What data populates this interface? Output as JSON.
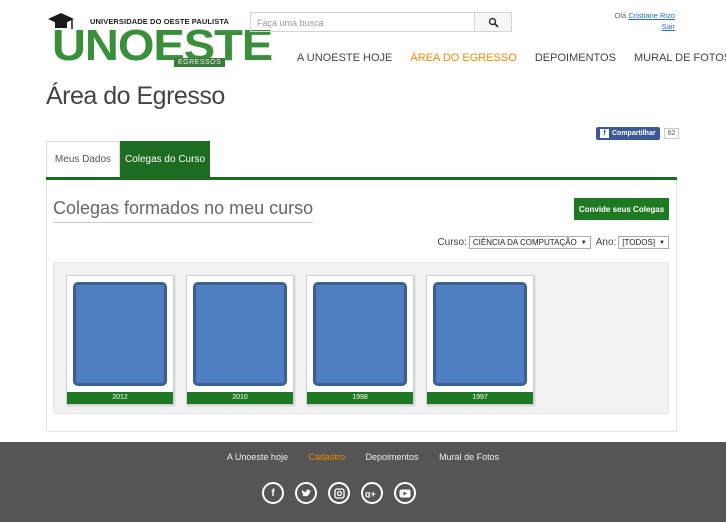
{
  "header": {
    "university_name": "UNIVERSIDADE DO OESTE PAULISTA",
    "brand": "UNOESTE",
    "brand_sub": "EGRESSOS",
    "search_placeholder": "Faça uma busca",
    "greeting": "Olá",
    "user_name": "Cristiane Rizo",
    "logout": "Sair"
  },
  "nav": {
    "items": [
      {
        "label": "A UNOESTE HOJE",
        "active": false
      },
      {
        "label": "ÁREA DO EGRESSO",
        "active": true
      },
      {
        "label": "DEPOIMENTOS",
        "active": false
      },
      {
        "label": "MURAL DE FOTOS",
        "active": false
      }
    ]
  },
  "page": {
    "title": "Área do Egresso",
    "share_label": "Compartilhar",
    "share_count": "62"
  },
  "tabs": [
    {
      "label": "Meus Dados",
      "active": false
    },
    {
      "label": "Colegas do Curso",
      "active": true
    }
  ],
  "section": {
    "title": "Colegas formados no meu curso",
    "invite_button": "Convide seus Colegas",
    "course_label": "Curso:",
    "course_value": "CIÊNCIA DA COMPUTAÇÃO",
    "year_label": "Ano:",
    "year_value": "[TODOS]"
  },
  "gallery": [
    {
      "year": "2012"
    },
    {
      "year": "2010"
    },
    {
      "year": "1998"
    },
    {
      "year": "1997"
    }
  ],
  "footer": {
    "links": [
      {
        "label": "A Unoeste hoje",
        "active": false
      },
      {
        "label": "Cadastro",
        "active": true
      },
      {
        "label": "Depoimentos",
        "active": false
      },
      {
        "label": "Mural de Fotos",
        "active": false
      }
    ],
    "social": [
      "facebook-icon",
      "twitter-icon",
      "instagram-icon",
      "google-plus-icon",
      "youtube-icon"
    ]
  },
  "colors": {
    "brand_green": "#1e7a22",
    "accent_orange": "#f08a00",
    "photo_blue": "#4f7ec1",
    "footer_bg": "#555555"
  }
}
